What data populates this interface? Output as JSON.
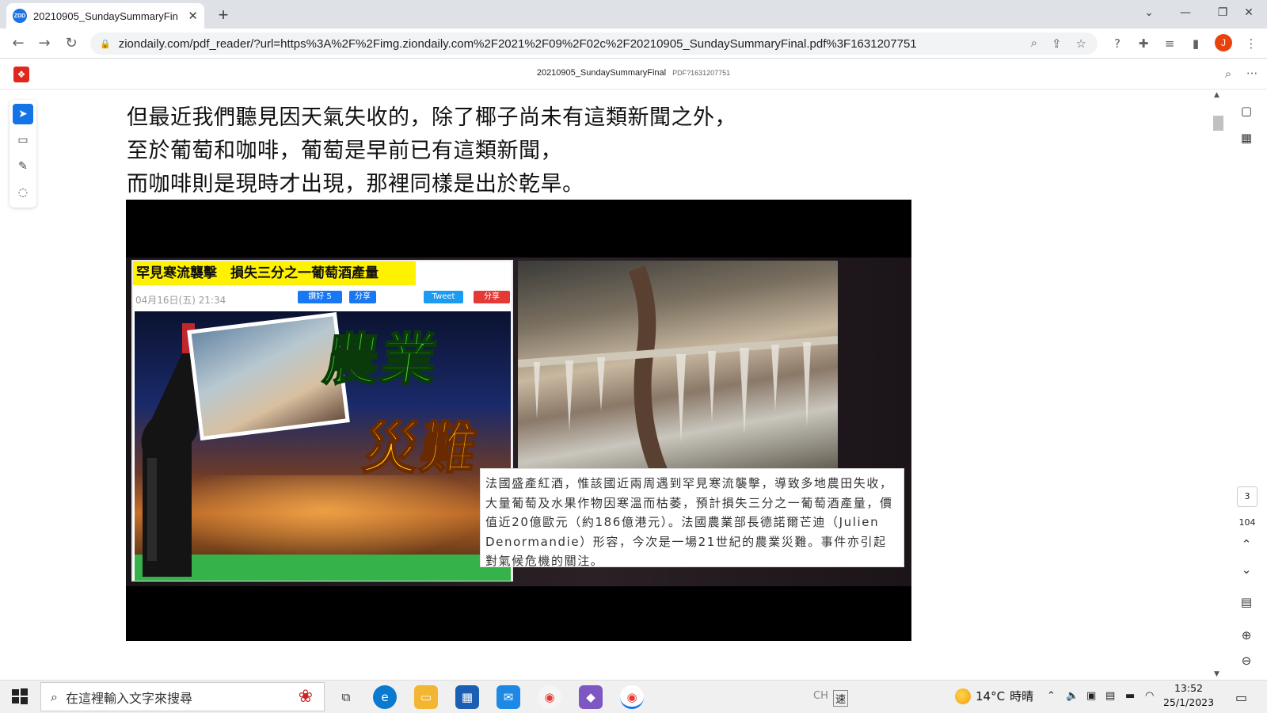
{
  "browser": {
    "tab_title": "20210905_SundaySummaryFin",
    "tab_favicon": "ZDD",
    "address": "ziondaily.com/pdf_reader/?url=https%3A%2F%2Fimg.ziondaily.com%2F2021%2F09%2F02c%2F20210905_SundaySummaryFinal.pdf%3F1631207751",
    "avatar_letter": "J"
  },
  "pdf": {
    "title": "20210905_SundaySummaryFinal",
    "query": "PDF?1631207751",
    "page_current": "3",
    "page_total": "104"
  },
  "body_lines": [
    "但最近我們聽見因天氣失收的，除了椰子尚未有這類新聞之外，",
    "至於葡萄和咖啡，葡萄是早前已有這類新聞，",
    "而咖啡則是現時才出現，那裡同樣是出於乾旱。"
  ],
  "news": {
    "headline": "罕見寒流襲擊　損失三分之一葡萄酒產量",
    "date": "04月16日(五) 21:34",
    "share_fb": "讚好 5",
    "share": "分享",
    "tweet": "Tweet",
    "share_red": "分享",
    "word_top": "農業",
    "word_bottom": "災難",
    "caption": "法國盛產紅酒，惟該國近兩周遇到罕見寒流襲擊，導致多地農田失收，大量葡萄及水果作物因寒溫而枯萎，預計損失三分之一葡萄酒產量，價值近20億歐元（約186億港元）。法國農業部長德諾爾芒迪（Julien Denormandie）形容，今次是一場21世紀的農業災難。事件亦引起對氣候危機的關注。"
  },
  "taskbar": {
    "search_placeholder": "在這裡輸入文字來搜尋",
    "weather_temp": "14°C",
    "weather_desc": "時晴",
    "ime": "CH",
    "ime2": "速",
    "time": "13:52",
    "date": "25/1/2023"
  },
  "colors": {
    "accent": "#1473e6",
    "pdf_red": "#e1261c",
    "headline_bg": "#fff200"
  }
}
